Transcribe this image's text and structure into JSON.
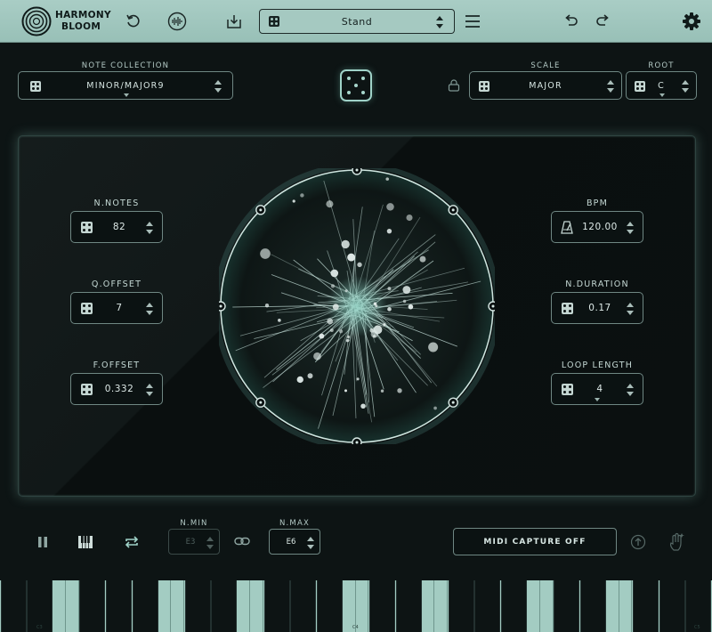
{
  "app": {
    "name_line1": "HARMONY",
    "name_line2": "BLOOM"
  },
  "toolbar": {
    "preset_label": "Stand",
    "icons": [
      "reload-icon",
      "waveform-icon",
      "download-icon",
      "dice-icon",
      "menu-icon",
      "undo-icon",
      "redo-icon",
      "gear-icon"
    ]
  },
  "note_collection": {
    "caption": "NOTE COLLECTION",
    "value": "MINOR/MAJOR9"
  },
  "scale": {
    "caption": "SCALE",
    "value": "MAJOR"
  },
  "root": {
    "caption": "ROOT",
    "value": "C"
  },
  "params_left": [
    {
      "caption": "N.NOTES",
      "value": "82"
    },
    {
      "caption": "Q.OFFSET",
      "value": "7"
    },
    {
      "caption": "F.OFFSET",
      "value": "0.332"
    }
  ],
  "params_right": [
    {
      "caption": "BPM",
      "value": "120.00"
    },
    {
      "caption": "N.DURATION",
      "value": "0.17"
    },
    {
      "caption": "LOOP LENGTH",
      "value": "4"
    }
  ],
  "range": {
    "min_caption": "N.MIN",
    "min_value": "E3",
    "max_caption": "N.MAX",
    "max_value": "E6"
  },
  "midi_capture_label": "MIDI CAPTURE OFF",
  "keyboard": {
    "labels": [
      "C3",
      "C4",
      "C5"
    ]
  },
  "colors": {
    "accent": "#9fd2c8",
    "topbar": "#a3c8c0",
    "background": "#0d1414"
  }
}
